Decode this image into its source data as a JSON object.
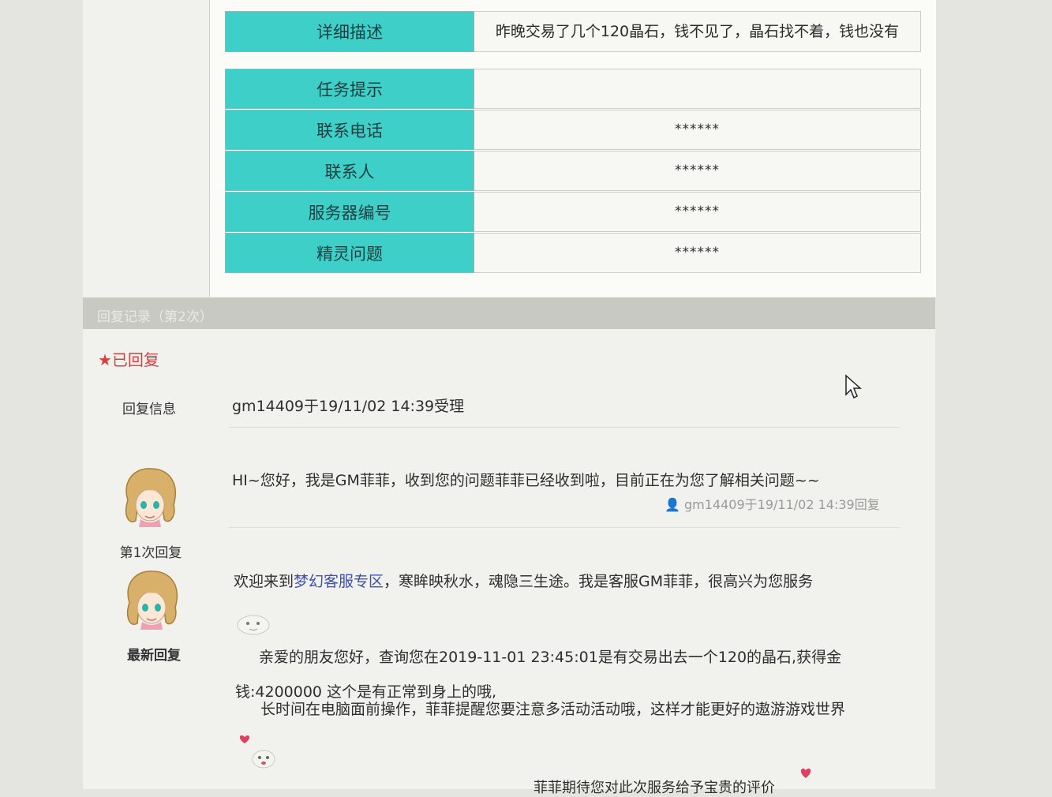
{
  "table": {
    "rows": [
      {
        "label": "详细描述",
        "value": "昨晚交易了几个120晶石，钱不见了，晶石找不着，钱也没有"
      },
      {
        "label": "任务提示",
        "value": ""
      },
      {
        "label": "联系电话",
        "value": "******"
      },
      {
        "label": "联系人",
        "value": "******"
      },
      {
        "label": "服务器编号",
        "value": "******"
      },
      {
        "label": "精灵问题",
        "value": "******"
      }
    ]
  },
  "section": {
    "title": "回复记录（第2次）"
  },
  "status": "★已回复",
  "reply_info": {
    "label": "回复信息",
    "text": "gm14409于19/11/02 14:39受理"
  },
  "reply1": {
    "label": "第1次回复",
    "text": "HI~您好，我是GM菲菲，收到您的问题菲菲已经收到啦，目前正在为您了解相关问题~~",
    "meta": "gm14409于19/11/02 14:39回复"
  },
  "latest": {
    "label": "最新回复",
    "greeting_before": "欢迎来到",
    "greeting_link": "梦幻客服专区",
    "greeting_after": "，寒眸映秋水，魂隐三生途。我是客服GM菲菲，很高兴为您服务",
    "para1_line1": "亲爱的朋友您好，查询您在2019-11-01 23:45:01是有交易出去一个120的晶石,获得金",
    "para1_line2": "钱:4200000 这个是有正常到身上的哦,",
    "para2": "长时间在电脑面前操作，菲菲提醒您要注意多活动活动哦，这样才能更好的遨游游戏世界",
    "para3": "菲菲期待您对此次服务给予宝贵的评价"
  },
  "colors": {
    "label_bg": "#3ecfc9",
    "status_red": "#d64040",
    "link_blue": "#3b4fb5"
  },
  "icons": [
    "user-icon",
    "gm-avatar",
    "emoticon",
    "mouse-cursor"
  ]
}
